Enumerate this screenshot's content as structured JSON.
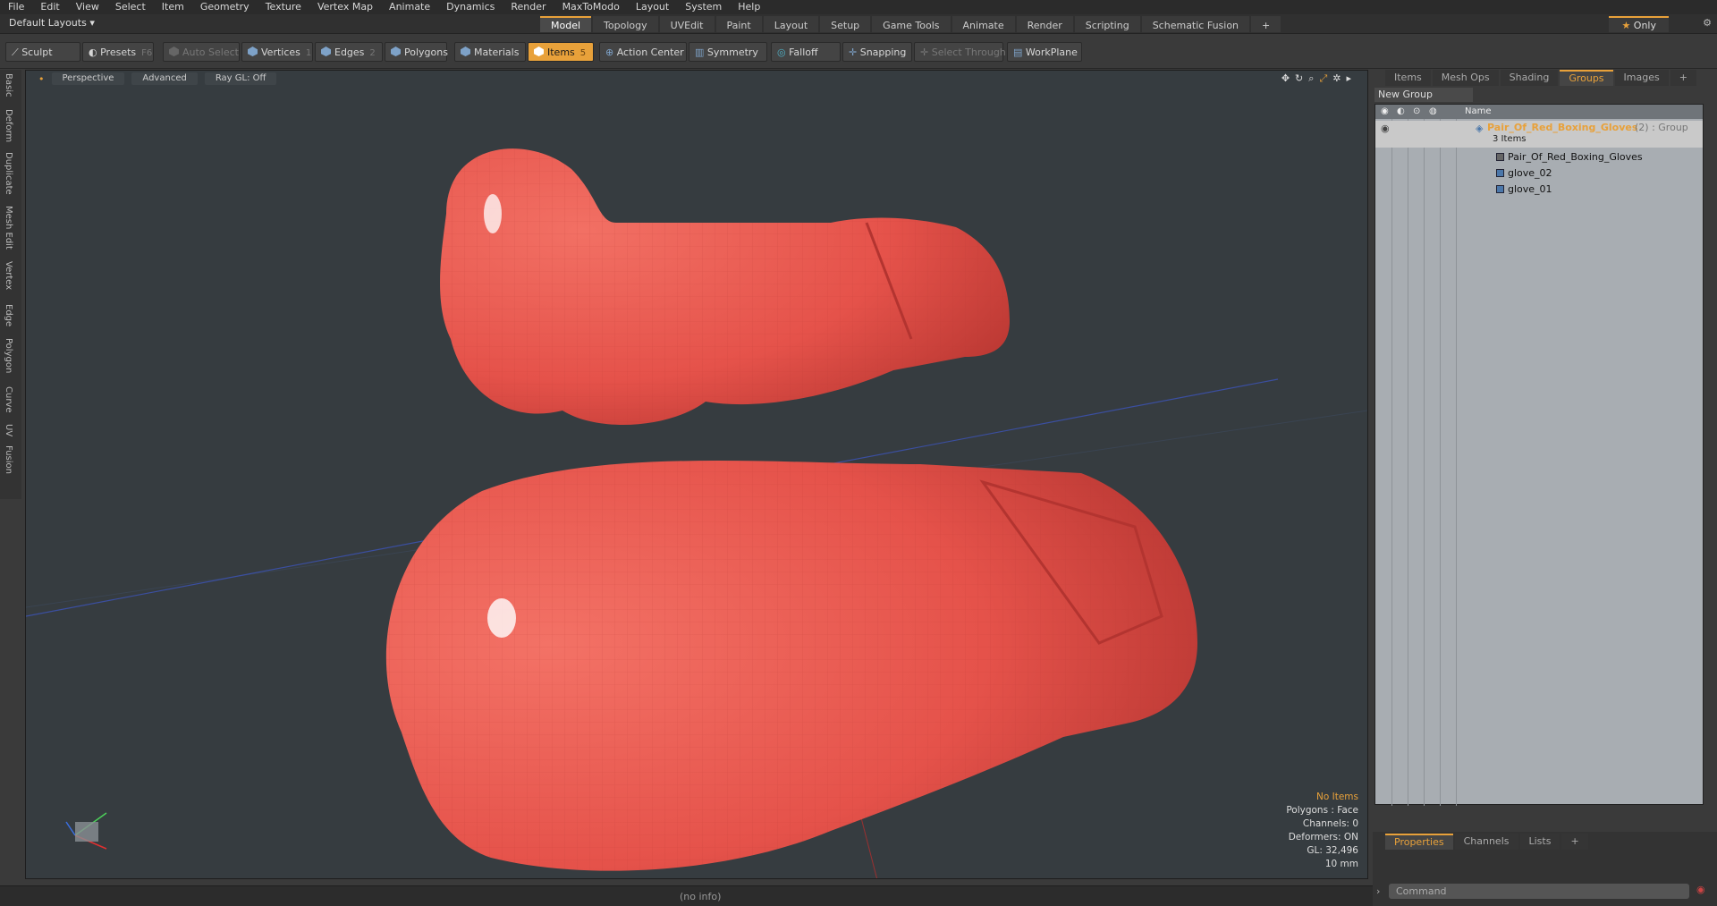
{
  "menu": [
    "File",
    "Edit",
    "View",
    "Select",
    "Item",
    "Geometry",
    "Texture",
    "Vertex Map",
    "Animate",
    "Dynamics",
    "Render",
    "MaxToModo",
    "Layout",
    "System",
    "Help"
  ],
  "layout_selector": "Default Layouts",
  "layout_tabs": [
    "Model",
    "Topology",
    "UVEdit",
    "Paint",
    "Layout",
    "Setup",
    "Game Tools",
    "Animate",
    "Render",
    "Scripting",
    "Schematic Fusion"
  ],
  "only_label": "Only",
  "toolbar": {
    "sculpt": "Sculpt",
    "presets": "Presets",
    "presets_key": "F6",
    "auto_select": "Auto Select",
    "vertices": "Vertices",
    "vertices_key": "1",
    "edges": "Edges",
    "edges_key": "2",
    "polygons": "Polygons",
    "materials": "Materials",
    "items": "Items",
    "items_key": "5",
    "action_center": "Action Center",
    "symmetry": "Symmetry",
    "falloff": "Falloff",
    "snapping": "Snapping",
    "select_through": "Select Through",
    "workplane": "WorkPlane"
  },
  "left_tabs": [
    "Basic",
    "Deform",
    "Duplicate",
    "Mesh Edit",
    "Vertex",
    "Edge",
    "Polygon",
    "Curve",
    "UV",
    "Fusion"
  ],
  "viewport": {
    "view": "Perspective",
    "shading": "Advanced",
    "raygl": "Ray GL: Off"
  },
  "info": {
    "items": "No Items",
    "polygons": "Polygons : Face",
    "channels": "Channels: 0",
    "deformers": "Deformers: ON",
    "gl": "GL: 32,496",
    "scale": "10 mm"
  },
  "status": "(no info)",
  "right_tabs": [
    "Items",
    "Mesh Ops",
    "Shading",
    "Groups",
    "Images"
  ],
  "new_group": "New Group",
  "tree": {
    "name_header": "Name",
    "group_name": "Pair_Of_Red_Boxing_Gloves",
    "group_suffix": "(2) : Group",
    "group_count": "3 Items",
    "children": [
      "Pair_Of_Red_Boxing_Gloves",
      "glove_02",
      "glove_01"
    ]
  },
  "bottom_tabs": [
    "Properties",
    "Channels",
    "Lists"
  ],
  "command_placeholder": "Command",
  "colors": {
    "accent": "#e8a13a",
    "glove": "#e5524a",
    "viewport_bg": "#363c40"
  }
}
